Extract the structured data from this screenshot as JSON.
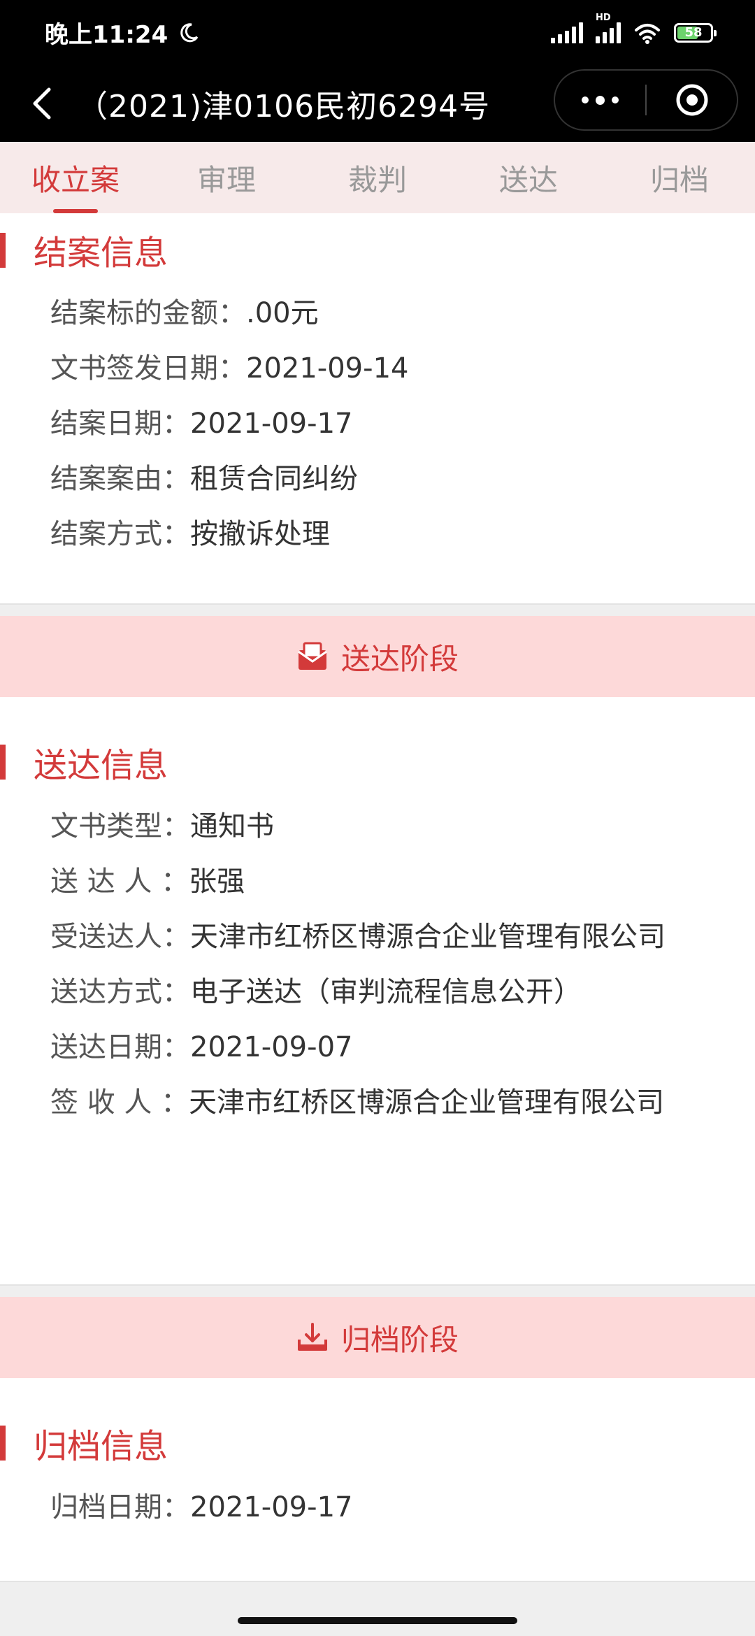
{
  "status": {
    "time": "晚上11:24",
    "battery": "58",
    "network": "HD"
  },
  "titlebar": {
    "title": "（2021)津0106民初6294号"
  },
  "tabs": [
    {
      "label": "收立案",
      "active": true
    },
    {
      "label": "审理",
      "active": false
    },
    {
      "label": "裁判",
      "active": false
    },
    {
      "label": "送达",
      "active": false
    },
    {
      "label": "归档",
      "active": false
    }
  ],
  "closing": {
    "title": "结案信息",
    "rows": [
      {
        "label": "结案标的金额：",
        "value": ".00元"
      },
      {
        "label": "文书签发日期：",
        "value": "2021-09-14"
      },
      {
        "label": "结案日期：",
        "value": "2021-09-17"
      },
      {
        "label": "结案案由：",
        "value": "租赁合同纠纷"
      },
      {
        "label": "结案方式：",
        "value": "按撤诉处理"
      }
    ]
  },
  "delivery_stage": {
    "label": "送达阶段"
  },
  "delivery": {
    "title": "送达信息",
    "rows": [
      {
        "label": "文书类型：",
        "value": "通知书"
      },
      {
        "label": "送 达 人 ：",
        "value": "张强"
      },
      {
        "label": "受送达人：",
        "value": "天津市红桥区博源合企业管理有限公司"
      },
      {
        "label": "送达方式：",
        "value": "电子送达（审判流程信息公开）"
      },
      {
        "label": "送达日期：",
        "value": "2021-09-07"
      },
      {
        "label": "签 收 人 ：",
        "value": "天津市红桥区博源合企业管理有限公司"
      }
    ]
  },
  "archive_stage": {
    "label": "归档阶段"
  },
  "archive": {
    "title": "归档信息",
    "rows": [
      {
        "label": "归档日期：",
        "value": "2021-09-17"
      }
    ]
  },
  "colors": {
    "accent": "#d33a3a",
    "stage_band": "#fdd9d9",
    "tab_bar": "#f7eaea"
  }
}
